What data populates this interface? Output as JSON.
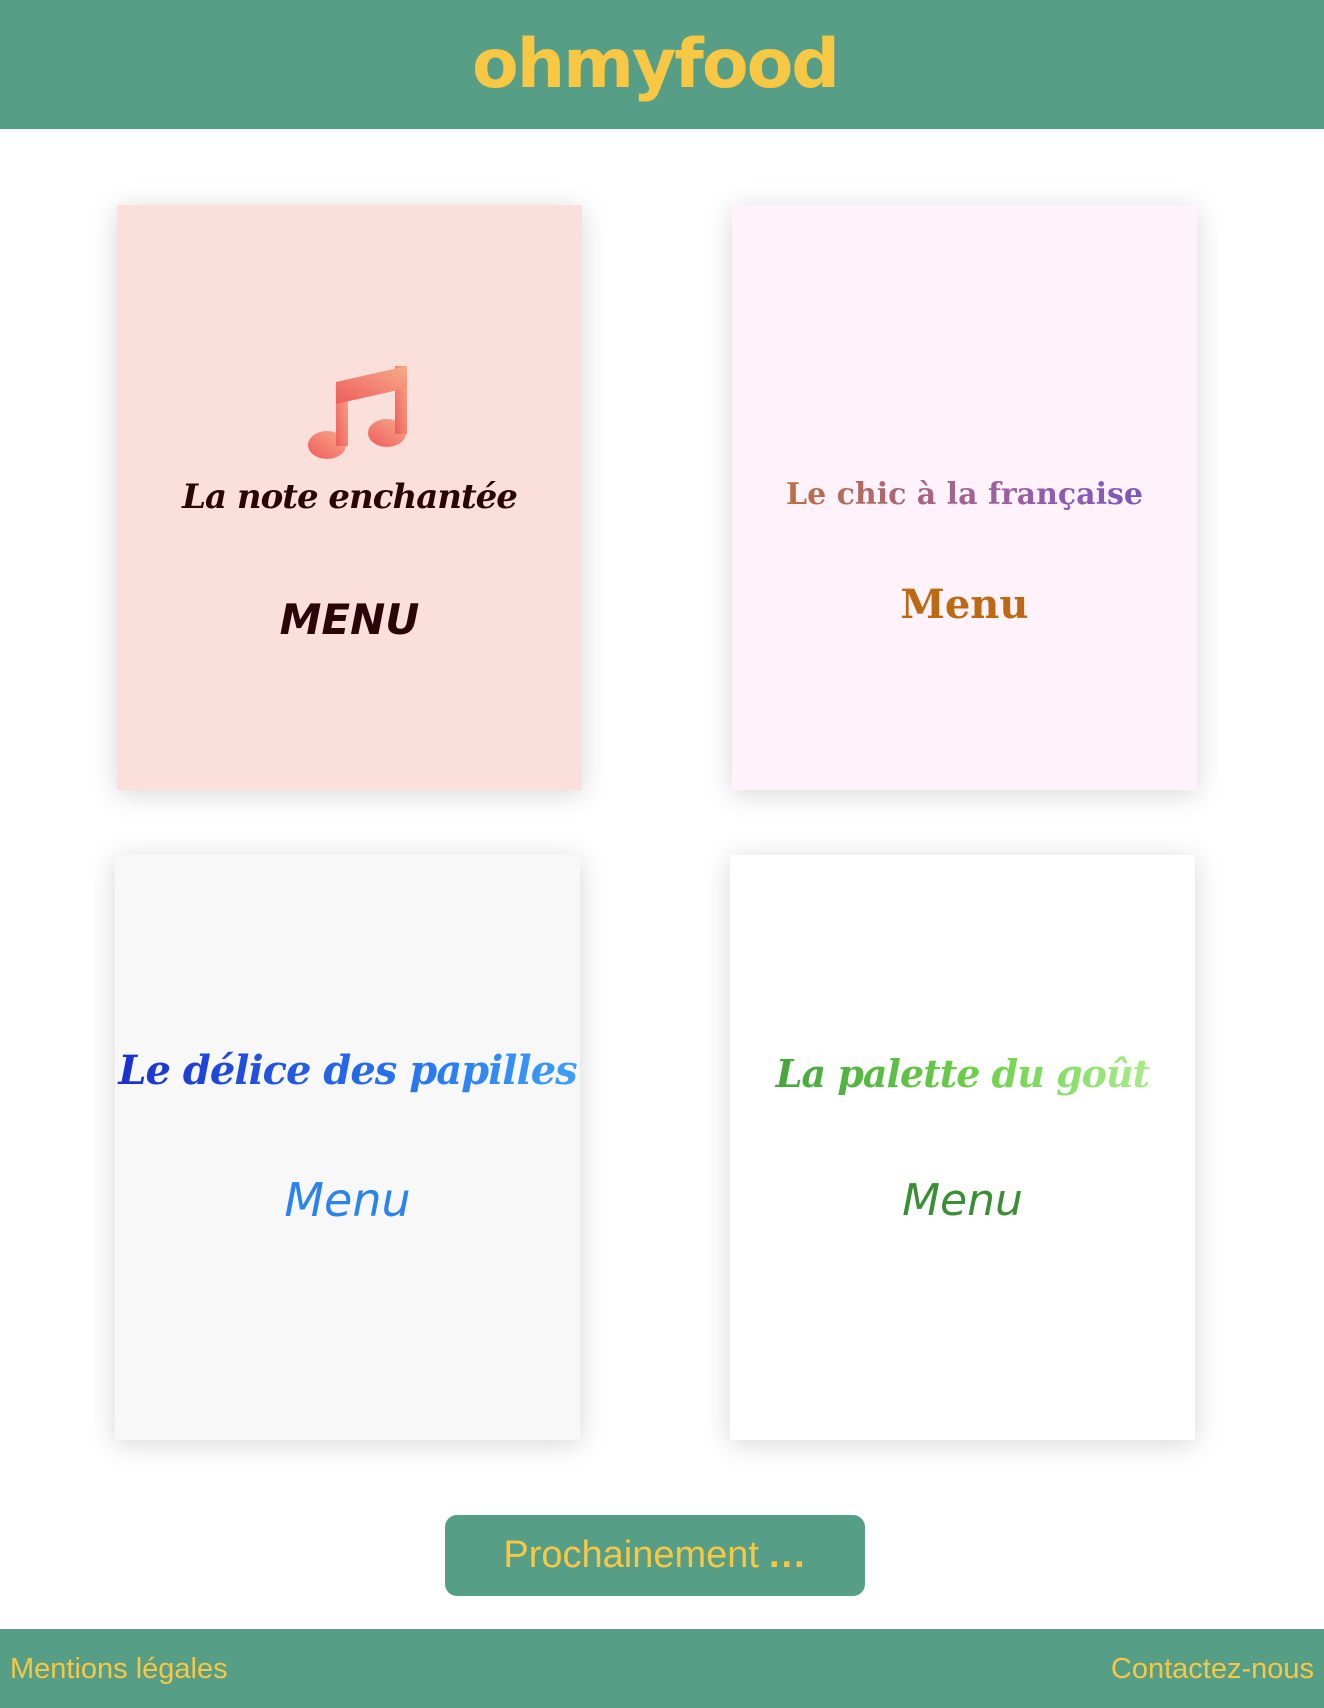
{
  "header": {
    "logo": "ohmyfood"
  },
  "restaurants": [
    {
      "name": "La note enchantée",
      "menu_label": "MENU",
      "icon": "music-note-icon"
    },
    {
      "name": "Le chic à la française",
      "menu_label": "Menu"
    },
    {
      "name": "Le délice des papilles",
      "menu_label": "Menu"
    },
    {
      "name": "La palette du goût",
      "menu_label": "Menu"
    }
  ],
  "soon_button": {
    "label": "Prochainement",
    "dots": "..."
  },
  "footer": {
    "legal": "Mentions légales",
    "contact": "Contactez-nous"
  },
  "colors": {
    "primary": "#579e86",
    "accent": "#f8c744",
    "card_1_bg": "#fbdfdb",
    "card_2_bg": "#fef3fa",
    "card_3_bg": "#f8f8f8",
    "card_4_bg": "#ffffff"
  }
}
